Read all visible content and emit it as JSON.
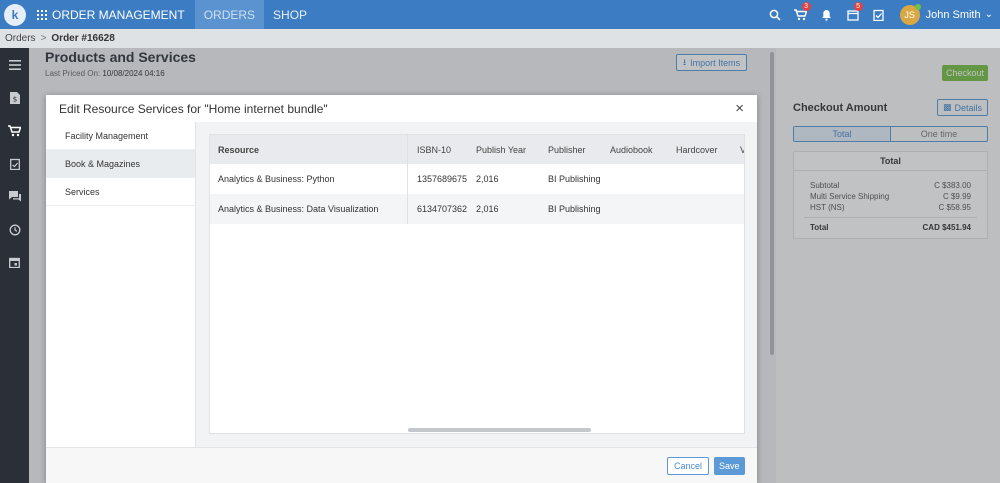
{
  "topbar": {
    "logo": "k",
    "app_title": "ORDER MANAGEMENT",
    "tabs": [
      {
        "label": "ORDERS",
        "active": true
      },
      {
        "label": "SHOP",
        "active": false
      }
    ],
    "icons": {
      "search": "search-icon",
      "cart": "cart-icon",
      "bell": "bell-icon",
      "calendar": "calendar-icon",
      "tasks": "clipboard-check-icon"
    },
    "cart_badge": "3",
    "calendar_badge": "5",
    "user_name": "John Smith",
    "avatar_initials": "JS"
  },
  "breadcrumb": {
    "parent": "Orders",
    "separator": ">",
    "current": "Order #16628"
  },
  "sidebar": {
    "icons": [
      "menu-icon",
      "invoice-icon",
      "cart-icon",
      "clipboard-icon",
      "chat-icon",
      "clock-icon",
      "calendar-icon"
    ]
  },
  "page": {
    "title": "Products and Services",
    "last_priced_label": "Last Priced On:",
    "last_priced_value": "10/08/2024 04:16",
    "import_button": "Import Items",
    "checkout_button": "Checkout",
    "checkout_amount_title": "Checkout Amount",
    "details_button": "Details",
    "segments": [
      "Total",
      "One time"
    ],
    "totals": {
      "header": "Total",
      "rows": [
        {
          "label": "Subtotal",
          "value": "C $383.00"
        },
        {
          "label": "Multi Service Shipping",
          "value": "C $9.99"
        },
        {
          "label": "HST (NS)",
          "value": "C $58.95"
        }
      ],
      "total_label": "Total",
      "total_value": "CAD $451.94"
    }
  },
  "modal": {
    "title": "Edit Resource Services for \"Home internet bundle\"",
    "close": "×",
    "tabs": [
      {
        "label": "Facility Management",
        "active": false
      },
      {
        "label": "Book & Magazines",
        "active": true
      },
      {
        "label": "Services",
        "active": false
      }
    ],
    "table": {
      "columns": [
        "Resource",
        "ISBN-10",
        "Publish Year",
        "Publisher",
        "Audiobook",
        "Hardcover",
        "V"
      ],
      "rows": [
        [
          "Analytics & Business: Python",
          "1357689675",
          "2,016",
          "BI Publishing",
          "",
          "",
          ""
        ],
        [
          "Analytics & Business: Data Visualization",
          "6134707362",
          "2,016",
          "BI Publishing",
          "",
          "",
          ""
        ]
      ]
    },
    "cancel": "Cancel",
    "save": "Save"
  },
  "colors": {
    "topbar": "#3c7cc2",
    "sidebar": "#2b3038",
    "accent": "#5b9ad6",
    "checkout": "#76c043",
    "badge": "#e2413f"
  }
}
